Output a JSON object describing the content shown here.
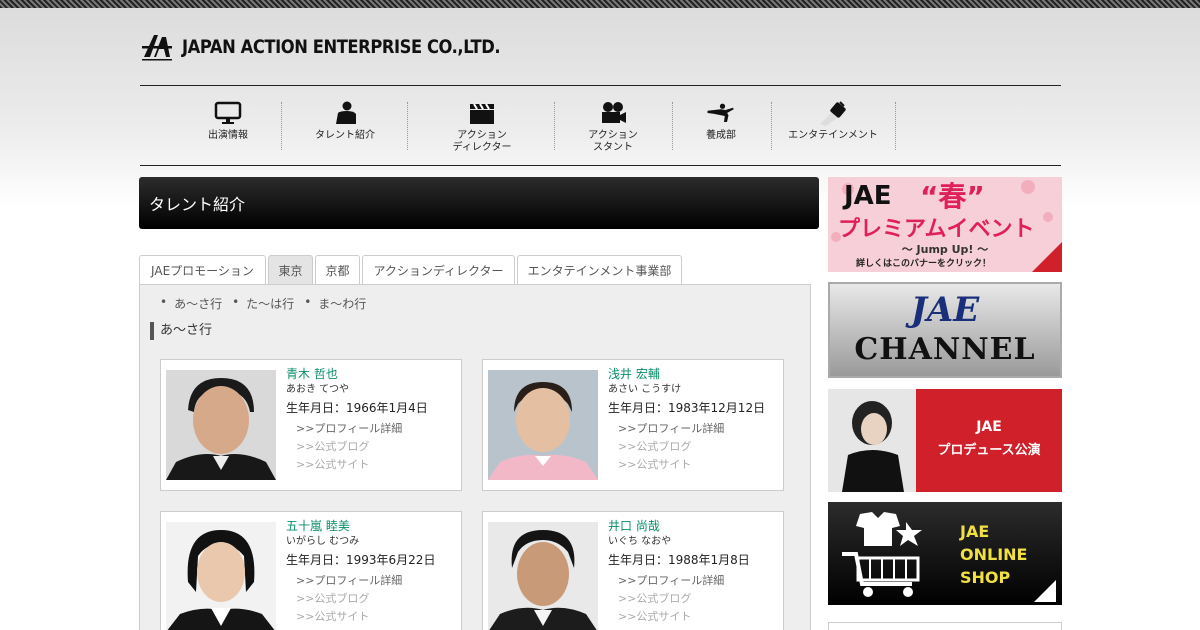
{
  "header": {
    "logo_text": "JAPAN ACTION ENTERPRISE CO.,LTD."
  },
  "nav": [
    {
      "label": "出演情報",
      "icon": "monitor-icon"
    },
    {
      "label": "タレント紹介",
      "icon": "person-icon"
    },
    {
      "label": "アクション\nディレクター",
      "icon": "clapperboard-icon"
    },
    {
      "label": "アクション\nスタント",
      "icon": "film-camera-icon"
    },
    {
      "label": "養成部",
      "icon": "kick-icon"
    },
    {
      "label": "エンタテインメント",
      "icon": "spotlight-icon"
    }
  ],
  "page_title": "タレント紹介",
  "tabs": [
    "JAEプロモーション",
    "東京",
    "京都",
    "アクションディレクター",
    "エンタテインメント事業部"
  ],
  "active_tab": "東京",
  "alpha_nav": [
    "あ〜さ行",
    "た〜は行",
    "ま〜わ行"
  ],
  "section_heading": "あ〜さ行",
  "talents": [
    {
      "name": "青木 哲也",
      "kana": "あおき てつや",
      "birth": "生年月日：1966年1月4日"
    },
    {
      "name": "浅井 宏輔",
      "kana": "あさい こうすけ",
      "birth": "生年月日：1983年12月12日"
    },
    {
      "name": "五十嵐 睦美",
      "kana": "いがらし むつみ",
      "birth": "生年月日：1993年6月22日"
    },
    {
      "name": "井口 尚哉",
      "kana": "いぐち なおや",
      "birth": "生年月日：1988年1月8日"
    }
  ],
  "card_links": {
    "profile": ">>プロフィール詳細",
    "blog": ">>公式ブログ",
    "site": ">>公式サイト"
  },
  "banners": {
    "premium": {
      "title_jae": "JAE",
      "title_spring": "“春”",
      "title_event": "プレミアムイベント",
      "sub": "〜 Jump Up! 〜",
      "note": "詳しくはこのバナーをクリック！"
    },
    "channel": {
      "line1": "JAE",
      "line2": "CHANNEL"
    },
    "produce": {
      "line1": "JAE",
      "line2": "プロデュース公演"
    },
    "shop": {
      "line1": "JAE",
      "line2": "ONLINE",
      "line3": "SHOP"
    }
  },
  "colors": {
    "accent_green": "#0a8f6a",
    "banner_red": "#d0202a",
    "shop_yellow": "#f0e040"
  }
}
